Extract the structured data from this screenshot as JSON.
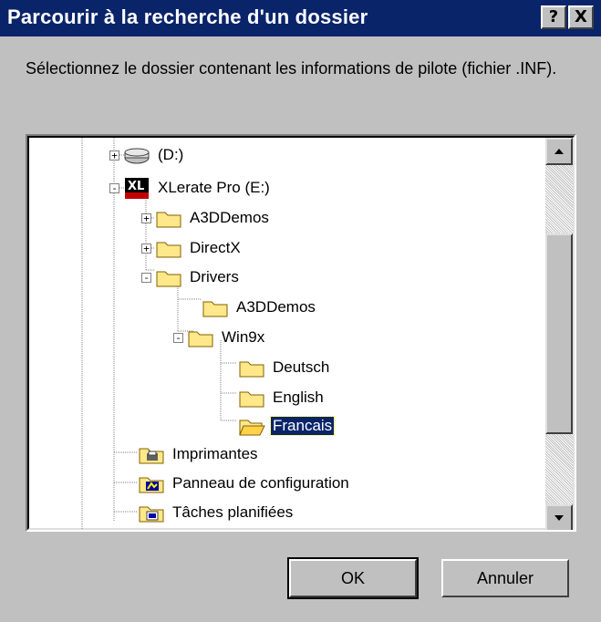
{
  "window": {
    "title": "Parcourir à la recherche d'un dossier",
    "help_button": "?",
    "close_button": "X"
  },
  "instruction": "Sélectionnez le dossier contenant les informations de pilote (fichier .INF).",
  "tree": {
    "items": [
      {
        "label": "(D:)",
        "icon": "drive-icon",
        "expander": "+"
      },
      {
        "label": "XLerate Pro (E:)",
        "icon": "cdrom-logo-icon",
        "expander": "-"
      },
      {
        "label": "A3DDemos",
        "icon": "folder-icon",
        "expander": "+"
      },
      {
        "label": "DirectX",
        "icon": "folder-icon",
        "expander": "+"
      },
      {
        "label": "Drivers",
        "icon": "folder-icon",
        "expander": "-"
      },
      {
        "label": "A3DDemos",
        "icon": "folder-icon",
        "expander": ""
      },
      {
        "label": "Win9x",
        "icon": "folder-icon",
        "expander": "-"
      },
      {
        "label": "Deutsch",
        "icon": "folder-icon",
        "expander": ""
      },
      {
        "label": "English",
        "icon": "folder-icon",
        "expander": ""
      },
      {
        "label": "Francais",
        "icon": "folder-open-icon",
        "expander": "",
        "selected": true
      },
      {
        "label": "Imprimantes",
        "icon": "printers-folder-icon",
        "expander": ""
      },
      {
        "label": "Panneau de configuration",
        "icon": "control-panel-icon",
        "expander": ""
      },
      {
        "label": "Tâches planifiées",
        "icon": "scheduled-tasks-icon",
        "expander": ""
      }
    ]
  },
  "buttons": {
    "ok": "OK",
    "cancel": "Annuler"
  },
  "colors": {
    "titlebar": "#0a246a",
    "face": "#c0c0c0",
    "selection": "#0a246a",
    "folder": "#ffe88a"
  }
}
